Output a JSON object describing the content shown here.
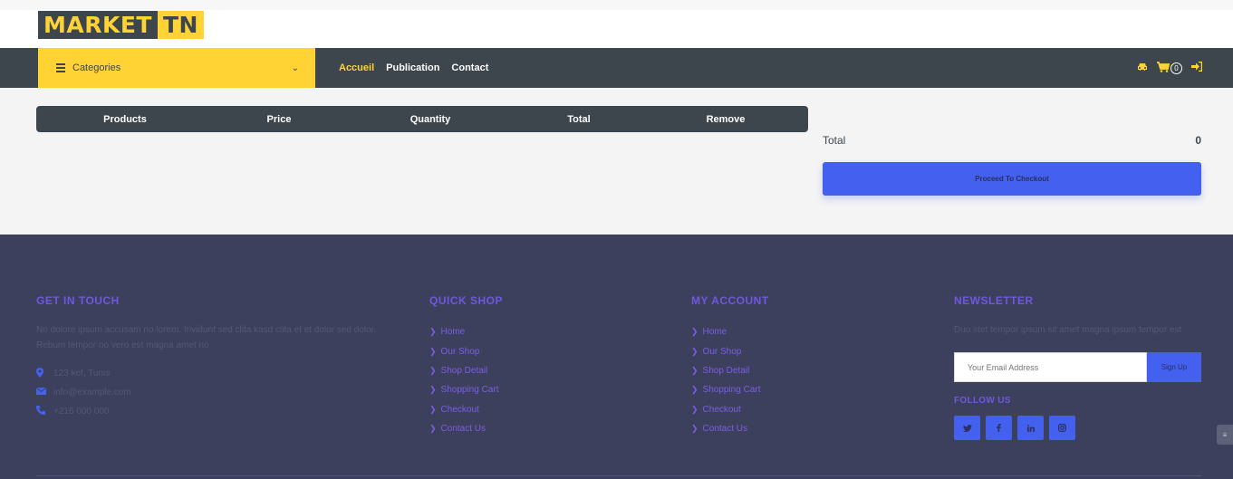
{
  "brand": {
    "part1": "MARKET",
    "part2": "TN"
  },
  "navbar": {
    "categories_label": "Categories",
    "links": [
      {
        "label": "Accueil",
        "active": true
      },
      {
        "label": "Publication",
        "active": false
      },
      {
        "label": "Contact",
        "active": false
      }
    ],
    "icons": [
      "car-icon",
      "shopping-cart-icon",
      "sign-in-icon"
    ],
    "cart_count": "0"
  },
  "cart": {
    "columns": [
      "Products",
      "Price",
      "Quantity",
      "Total",
      "Remove"
    ],
    "rows": []
  },
  "summary": {
    "total_label": "Total",
    "total_value": "0",
    "checkout_label": "Proceed To Checkout"
  },
  "footer": {
    "get_in_touch": {
      "title": "GET IN TOUCH",
      "text": "No dolore ipsum accusam no lorem. Invidunt sed clita kasd clita et et dolor sed dolor. Rebum tempor no vero est magna amet no",
      "address": "123 kef, Tunis",
      "email": "info@example.com",
      "phone": "+216 000 000"
    },
    "quick_shop": {
      "title": "QUICK SHOP",
      "links": [
        "Home",
        "Our Shop",
        "Shop Detail",
        "Shopping Cart",
        "Checkout",
        "Contact Us"
      ]
    },
    "my_account": {
      "title": "MY ACCOUNT",
      "links": [
        "Home",
        "Our Shop",
        "Shop Detail",
        "Shopping Cart",
        "Checkout",
        "Contact Us"
      ]
    },
    "newsletter": {
      "title": "NEWSLETTER",
      "text": "Duo stet tempor ipsum sit amet magna ipsum tempor est",
      "email_placeholder": "Your Email Address",
      "signup_label": "Sign Up",
      "follow_label": "FOLLOW US",
      "socials": [
        "twitter-icon",
        "facebook-icon",
        "linkedin-icon",
        "instagram-icon"
      ]
    }
  },
  "colors": {
    "accent_yellow": "#ffd333",
    "dark": "#3d464d",
    "primary_blue": "#4361ee",
    "footer_bg": "#3d405c",
    "footer_heading": "#6f57e0"
  }
}
